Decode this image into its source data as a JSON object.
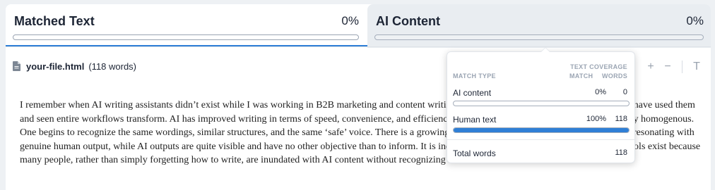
{
  "tabs": {
    "matched": {
      "title": "Matched Text",
      "percent": "0%",
      "fill": 0
    },
    "ai": {
      "title": "AI Content",
      "percent": "0%",
      "fill": 0
    }
  },
  "file": {
    "name": "your-file.html",
    "words": "(118 words)",
    "icon": "file-icon"
  },
  "toolbar": {
    "plus": "+",
    "minus": "−",
    "text_icon": "T"
  },
  "document": {
    "text": "I remember when AI writing assistants didn’t exist while I was working in B2B marketing and content writing. Since then, I have seen AI tools get good. I have used them and seen entire workflows transform. AI has improved writing in terms of speed, convenience, and efficiency, but the result of AI content has also been very homogenous. One begins to recognize the same wordings, similar structures, and the same ‘safe’ voice. There is a growing hunger for content that is distinguishable and resonating with genuine human output, while AI outputs are quite visible and have no other objective than to inform. It is indeed ironic that the existence of ‘humanized’ tools exist because many people, rather than simply forgetting how to write, are inundated with AI content without recognizing its own existence."
  },
  "popover": {
    "col_match_type": "MATCH TYPE",
    "col_text_coverage": "TEXT COVERAGE",
    "col_match": "MATCH",
    "col_words": "WORDS",
    "rows": [
      {
        "label": "AI content",
        "match": "0%",
        "words": "0",
        "fill": 0
      },
      {
        "label": "Human text",
        "match": "100%",
        "words": "118",
        "fill": 1
      }
    ],
    "total": {
      "label": "Total words",
      "words": "118"
    }
  },
  "colors": {
    "accent": "#2f7fd6",
    "text": "#1d2535",
    "muted": "#9ba5b3"
  }
}
